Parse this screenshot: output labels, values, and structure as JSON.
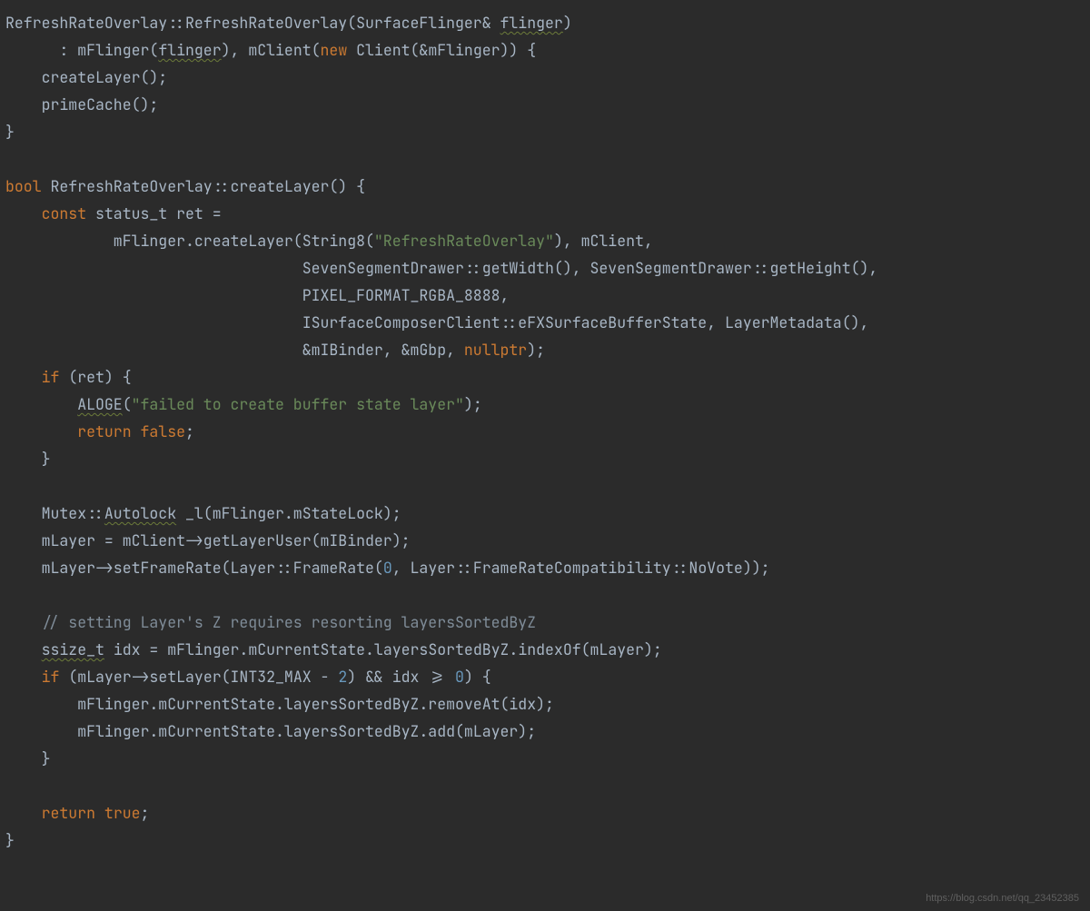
{
  "code": {
    "l1a": "RefreshRateOverlay::RefreshRateOverlay(SurfaceFlinger& ",
    "l1b": "flinger",
    "l1c": ")",
    "l2a": "      : mFlinger(",
    "l2b": "flinger",
    "l2c": "), mClient(",
    "l2_kw": "new",
    "l2d": " Client(&mFlinger)) {",
    "l3": "    createLayer();",
    "l4": "    primeCache();",
    "l5": "}",
    "l7_kw": "bool",
    "l7": " RefreshRateOverlay::createLayer() {",
    "l8a": "    ",
    "l8_kw": "const",
    "l8b": " status_t ret =",
    "l9a": "            mFlinger.createLayer(String8(",
    "l9_str": "\"RefreshRateOverlay\"",
    "l9b": "), mClient,",
    "l10": "                                 SevenSegmentDrawer::getWidth(), SevenSegmentDrawer::getHeight(),",
    "l11": "                                 PIXEL_FORMAT_RGBA_8888,",
    "l12": "                                 ISurfaceComposerClient::eFXSurfaceBufferState, LayerMetadata(),",
    "l13a": "                                 &mIBinder, &mGbp, ",
    "l13_kw": "nullptr",
    "l13b": ");",
    "l14a": "    ",
    "l14_kw": "if",
    "l14b": " (ret) {",
    "l15a": "        ",
    "l15b": "ALOGE",
    "l15c": "(",
    "l15_str": "\"failed to create buffer state layer\"",
    "l15d": ");",
    "l16a": "        ",
    "l16_kw": "return",
    "l16b": " ",
    "l16_kw2": "false",
    "l16c": ";",
    "l17": "    }",
    "l19a": "    Mutex::",
    "l19b": "Autolock",
    "l19c": " _l(mFlinger.mStateLock);",
    "l20": "    mLayer = mClient->getLayerUser(mIBinder);",
    "l21a": "    mLayer->setFrameRate(Layer::FrameRate(",
    "l21_n": "0",
    "l21b": ", Layer::FrameRateCompatibility::NoVote));",
    "l23_cmt": "    // setting Layer's Z requires resorting layersSortedByZ",
    "l24a": "    ",
    "l24b": "ssize_t",
    "l24c": " idx = mFlinger.mCurrentState.layersSortedByZ.indexOf(mLayer);",
    "l25a": "    ",
    "l25_kw": "if",
    "l25b": " (mLayer->setLayer(INT32_MAX - ",
    "l25_n": "2",
    "l25c": ") && idx >= ",
    "l25_n2": "0",
    "l25d": ") {",
    "l26": "        mFlinger.mCurrentState.layersSortedByZ.removeAt(idx);",
    "l27": "        mFlinger.mCurrentState.layersSortedByZ.add(mLayer);",
    "l28": "    }",
    "l30a": "    ",
    "l30_kw": "return",
    "l30b": " ",
    "l30_kw2": "true",
    "l30c": ";",
    "l31": "}"
  },
  "watermark": "https://blog.csdn.net/qq_23452385"
}
